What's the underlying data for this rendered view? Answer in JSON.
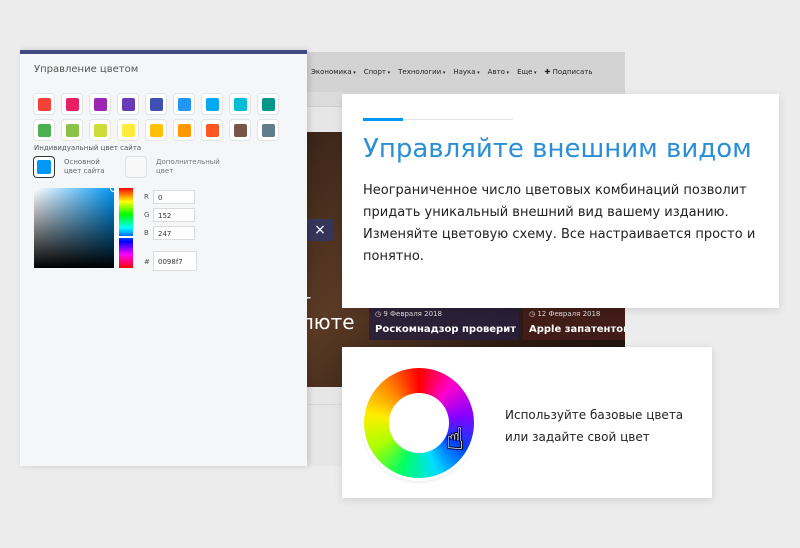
{
  "site": {
    "nav": [
      "Экономика",
      "Спорт",
      "Технологии",
      "Наука",
      "Авто",
      "Еще"
    ],
    "subscribe": "✚ Подписать",
    "close": "×",
    "hero_line1": "г",
    "hero_line2": "люте",
    "cards": [
      {
        "date": "◷ 9 Февраля 2018",
        "headline": "Роскомнадзор проверит"
      },
      {
        "date": "◷ 12 Февраля 2018",
        "headline": "Apple запатентова"
      }
    ]
  },
  "panel": {
    "title": "Управление цветом",
    "swatches_row1": [
      "#f44336",
      "#e91e63",
      "#9c27b0",
      "#673ab7",
      "#3f51b5",
      "#2196f3",
      "#03a9f4",
      "#00bcd4",
      "#009688"
    ],
    "swatches_row2": [
      "#4caf50",
      "#8bc34a",
      "#cddc39",
      "#ffeb3b",
      "#ffc107",
      "#ff9800",
      "#ff5722",
      "#795548",
      "#607d8b"
    ],
    "individual_label": "Индивидуальный цвет сайта",
    "main_color": "#0098f7",
    "main_label": "Основной цвет сайта",
    "additional_label": "Дополнительный цвет",
    "r_label": "R",
    "r_value": "0",
    "g_label": "G",
    "g_value": "152",
    "b_label": "B",
    "b_value": "247",
    "hex_label": "#",
    "hex_value": "0098f7"
  },
  "info": {
    "heading": "Управляйте внешним видом",
    "body": "Неограниченное число цветовых комбинаций позволит придать уникальный внешний вид вашему изданию. Изменяйте цветовую схему. Все настраивается просто и понятно."
  },
  "info2": {
    "text": "Используйте базовые цвета или задайте свой цвет"
  },
  "colors": {
    "accent": "#0098f7",
    "heading": "#2a8fd6",
    "panel_top": "#3f4a80"
  }
}
